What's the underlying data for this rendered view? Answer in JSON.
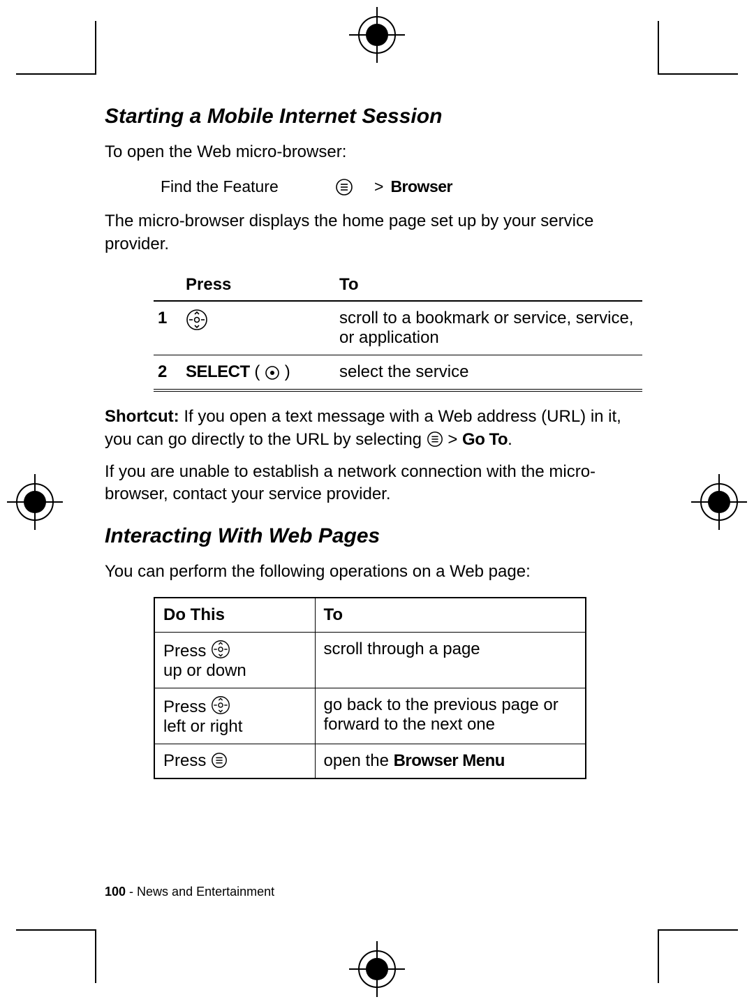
{
  "section1": {
    "heading": "Starting a Mobile Internet Session",
    "intro": "To open the Web micro-browser:",
    "feature_label": "Find the Feature",
    "feature_sep": ">",
    "feature_item": "Browser",
    "after": "The micro-browser displays the home page set up by your service provider.",
    "steps": {
      "col_press": "Press",
      "col_to": "To",
      "rows": [
        {
          "num": "1",
          "press_prefix": "",
          "press_label": "",
          "to": "scroll to a bookmark or service, service, or application"
        },
        {
          "num": "2",
          "press_prefix": "SELECT",
          "press_label": "",
          "to": "select the service"
        }
      ]
    },
    "shortcut_label": "Shortcut:",
    "shortcut_text_a": " If you open a text message with a Web address (URL) in it, you can go directly to the URL by selecting ",
    "shortcut_sep": " > ",
    "shortcut_goto": "Go To",
    "shortcut_period": ".",
    "trouble": "If you are unable to establish a network connection with the micro-browser, contact your service provider."
  },
  "section2": {
    "heading": "Interacting With Web Pages",
    "intro": "You can perform the following operations on a Web page:",
    "ops": {
      "col_do": "Do This",
      "col_to": "To",
      "rows": [
        {
          "do_a": "Press ",
          "do_b": "up or down",
          "to": "scroll through a page"
        },
        {
          "do_a": "Press ",
          "do_b": "left or right",
          "to": "go back to the previous page or forward to the next one"
        },
        {
          "do_a": "Press ",
          "do_b": "",
          "to_a": "open the ",
          "to_b": "Browser Menu"
        }
      ]
    }
  },
  "footer": {
    "page": "100",
    "sep": " - ",
    "chapter": "News and Entertainment"
  }
}
